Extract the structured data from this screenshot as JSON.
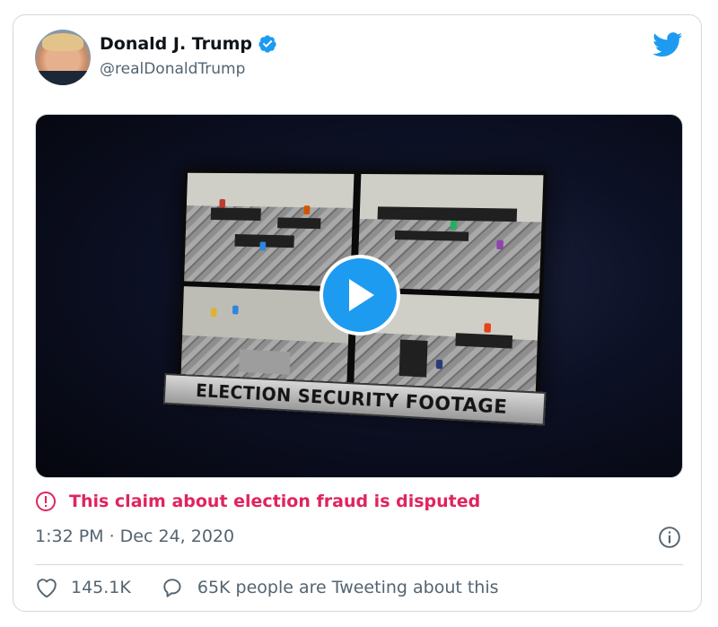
{
  "tweet": {
    "author_name": "Donald J. Trump",
    "author_handle": "@realDonaldTrump",
    "verified": true,
    "avatar_icon": "profile-photo",
    "platform_icon": "twitter-bird-icon",
    "brand_color": "#1d9bf0"
  },
  "media": {
    "type": "video",
    "overlay_text": "ELECTION SECURITY FOOTAGE",
    "play_icon": "play-icon"
  },
  "label": {
    "icon": "exclamation-circle-icon",
    "text": "This claim about election fraud is disputed",
    "color": "#e0245e"
  },
  "timestamp": "1:32 PM · Dec 24, 2020",
  "info_icon": "info-icon",
  "stats": {
    "likes": "145.1K",
    "like_icon": "heart-icon",
    "reply_icon": "speech-bubble-icon",
    "tweeting_text": "65K people are Tweeting about this"
  }
}
